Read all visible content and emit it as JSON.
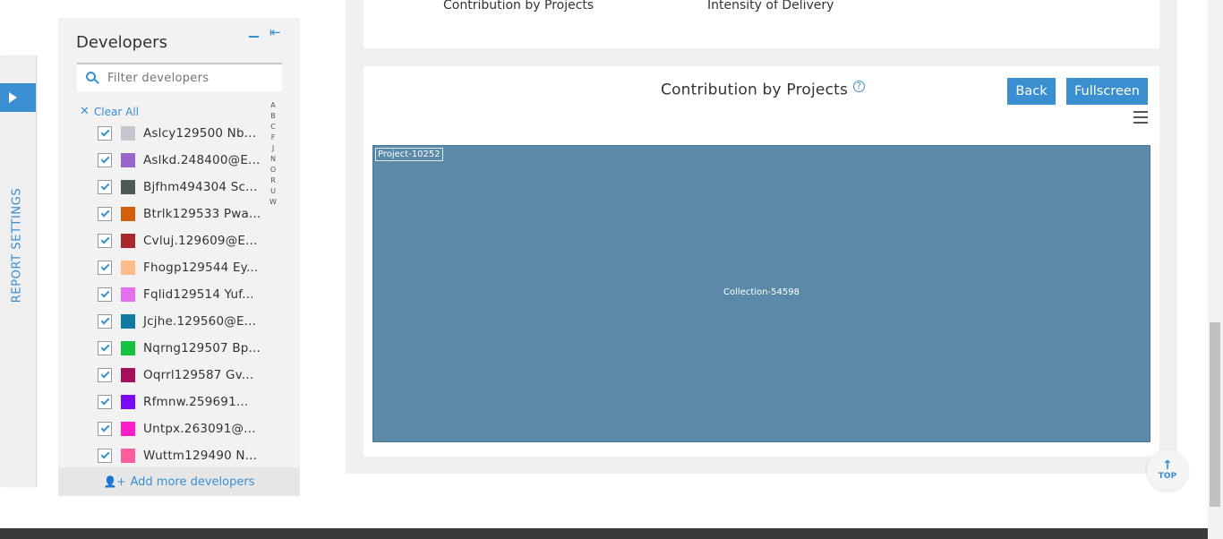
{
  "sidebar_rail": {
    "label": "REPORT SETTINGS"
  },
  "developers_panel": {
    "title": "Developers",
    "filter_placeholder": "Filter developers",
    "clear_all": "Clear All",
    "alpha_index": [
      "A",
      "B",
      "C",
      "F",
      "J",
      "N",
      "O",
      "R",
      "U",
      "W"
    ],
    "add_more": "Add more developers",
    "developers": [
      {
        "name": "Aslcy129500 Nb...",
        "color": "#c8c3cf",
        "checked": true
      },
      {
        "name": "Aslkd.248400@E...",
        "color": "#9966cc",
        "checked": true
      },
      {
        "name": "Bjfhm494304 Sc...",
        "color": "#4e5a55",
        "checked": true
      },
      {
        "name": "Btrlk129533 Pwa...",
        "color": "#d2600a",
        "checked": true
      },
      {
        "name": "Cvluj.129609@E...",
        "color": "#a8282b",
        "checked": true
      },
      {
        "name": "Fhogp129544 Ey...",
        "color": "#ffbb88",
        "checked": true
      },
      {
        "name": "Fqlid129514 Yuf...",
        "color": "#e66ef0",
        "checked": true
      },
      {
        "name": "Jcjhe.129560@E...",
        "color": "#0e7ba0",
        "checked": true
      },
      {
        "name": "Nqrng129507 Bp...",
        "color": "#15c23e",
        "checked": true
      },
      {
        "name": "Oqrrl129587 Gv...",
        "color": "#a60f5d",
        "checked": true
      },
      {
        "name": "Rfmnw.259691...",
        "color": "#7a0af5",
        "checked": true
      },
      {
        "name": "Untpx.263091@...",
        "color": "#ff1ccc",
        "checked": true
      },
      {
        "name": "Wuttm129490 N...",
        "color": "#ff5e9a",
        "checked": true
      }
    ]
  },
  "top_card": {
    "links": [
      "Contribution by Projects",
      "Intensity of Delivery"
    ]
  },
  "chart_card": {
    "title": "Contribution by Projects",
    "back_label": "Back",
    "fullscreen_label": "Fullscreen",
    "treemap": {
      "project_label": "Project-10252",
      "collection_label": "Collection-54598",
      "color": "#5b89a8"
    }
  },
  "top_button": {
    "label": "TOP"
  }
}
